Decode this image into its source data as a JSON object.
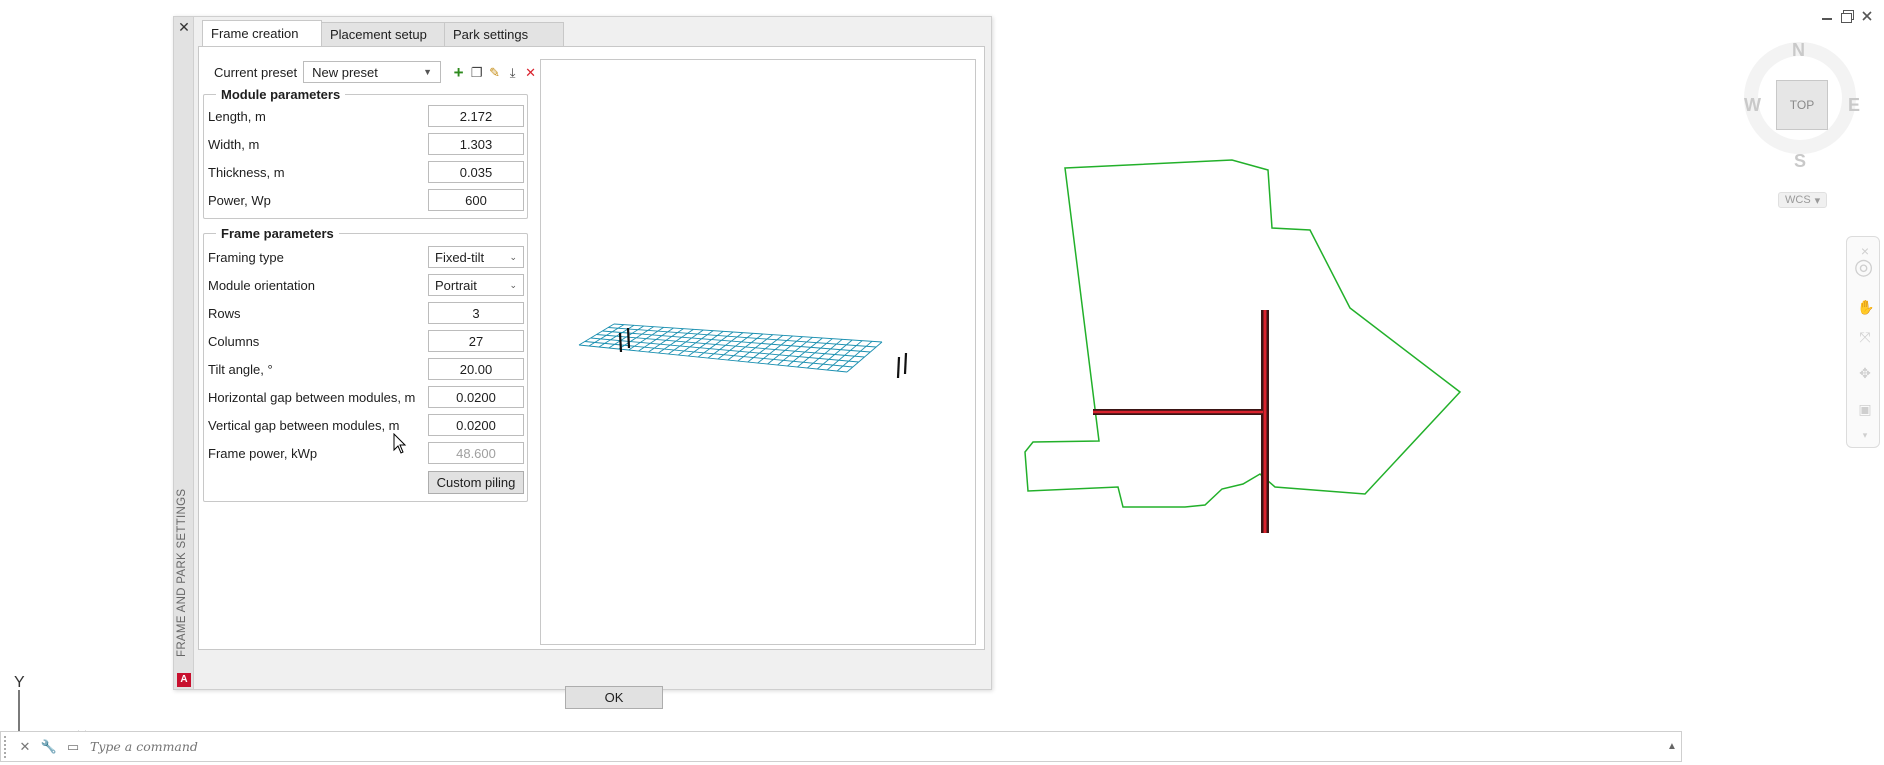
{
  "window": {
    "minimize_icon": "minimize-icon",
    "restore_icon": "restore-icon",
    "close_icon": "close-icon"
  },
  "viewcube": {
    "north": "N",
    "south": "S",
    "west": "W",
    "east": "E",
    "face": "TOP",
    "wcs": "WCS"
  },
  "palette": {
    "side_title": "FRAME AND PARK SETTINGS",
    "close_glyph": "✕",
    "logo_letter": "A",
    "tabs": [
      {
        "label": "Frame creation",
        "active": true
      },
      {
        "label": "Placement setup",
        "active": false
      },
      {
        "label": "Park settings",
        "active": false
      }
    ],
    "preset": {
      "label": "Current preset",
      "value": "New preset"
    },
    "module_parameters": {
      "title": "Module parameters",
      "rows": [
        {
          "label": "Length, m",
          "value": "2.172"
        },
        {
          "label": "Width, m",
          "value": "1.303"
        },
        {
          "label": "Thickness, m",
          "value": "0.035"
        },
        {
          "label": "Power, Wp",
          "value": "600"
        }
      ]
    },
    "frame_parameters": {
      "title": "Frame parameters",
      "framing_type": {
        "label": "Framing type",
        "value": "Fixed-tilt"
      },
      "module_orientation": {
        "label": "Module orientation",
        "value": "Portrait"
      },
      "rows": {
        "label": "Rows",
        "value": "3"
      },
      "columns": {
        "label": "Columns",
        "value": "27"
      },
      "tilt": {
        "label": "Tilt angle, °",
        "value": "20.00"
      },
      "h_gap": {
        "label": "Horizontal gap between modules, m",
        "value": "0.0200"
      },
      "v_gap": {
        "label": "Vertical gap between modules, m",
        "value": "0.0200"
      },
      "frame_power": {
        "label": "Frame power, kWp",
        "value": "48.600"
      },
      "custom_piling": "Custom piling"
    },
    "ok": "OK"
  },
  "command_line": {
    "placeholder": "Type a command"
  },
  "ucs": {
    "y_axis": "Y"
  },
  "colors": {
    "boundary": "#22b02a",
    "road": "#d9232e",
    "module_grid": "#1a8fb0",
    "logo": "#c8102e"
  }
}
